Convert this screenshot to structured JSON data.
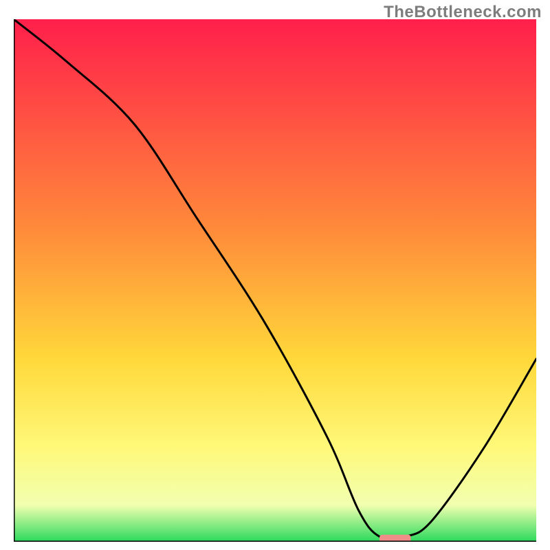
{
  "watermark": "TheBottleneck.com",
  "chart_data": {
    "type": "line",
    "title": "",
    "xlabel": "",
    "ylabel": "",
    "xlim": [
      0,
      100
    ],
    "ylim": [
      0,
      100
    ],
    "grid": false,
    "gradient_stops": [
      {
        "offset": 0.0,
        "color": "#ff1f4b"
      },
      {
        "offset": 0.4,
        "color": "#ff8a3a"
      },
      {
        "offset": 0.65,
        "color": "#ffd83a"
      },
      {
        "offset": 0.82,
        "color": "#fff97a"
      },
      {
        "offset": 0.93,
        "color": "#f1ffb0"
      },
      {
        "offset": 1.0,
        "color": "#2ad95b"
      }
    ],
    "series": [
      {
        "name": "bottleneck-curve",
        "color": "#000000",
        "x": [
          0,
          10,
          23,
          35,
          48,
          60,
          66,
          70,
          75,
          80,
          90,
          100
        ],
        "y": [
          100,
          92,
          80,
          62,
          42,
          20,
          6,
          1,
          1,
          4,
          18,
          35
        ]
      }
    ],
    "marker": {
      "name": "optimal-marker",
      "color": "#ef8d89",
      "x_start": 70,
      "x_end": 76,
      "y": 0.6,
      "height": 1.5
    },
    "axes": {
      "color": "#000000",
      "width": 3
    }
  }
}
